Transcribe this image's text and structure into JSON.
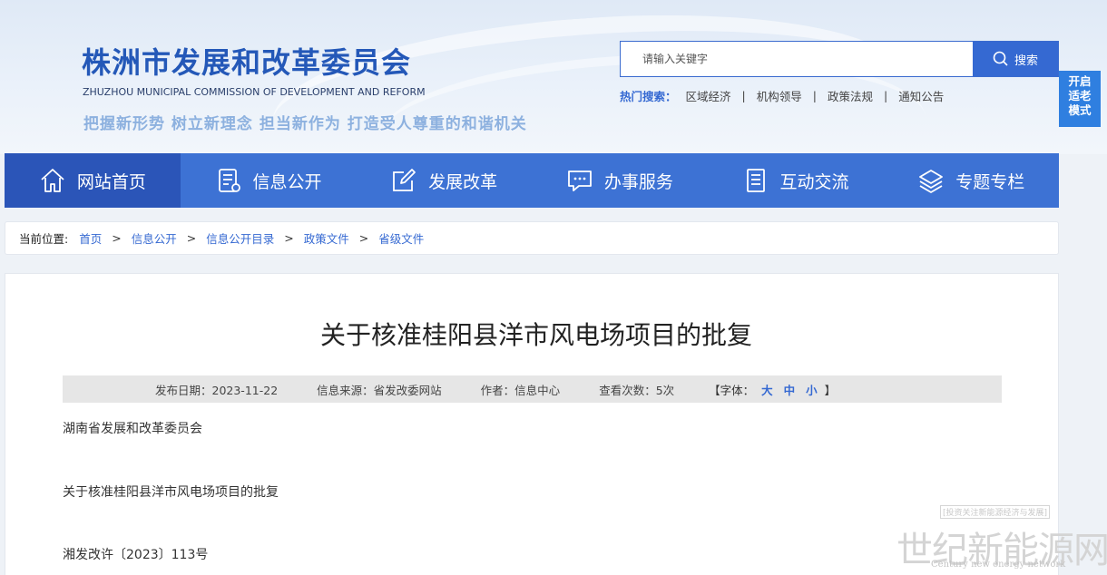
{
  "header": {
    "title_cn": "株洲市发展和改革委员会",
    "title_en": "ZHUZHOU MUNICIPAL COMMISSION OF DEVELOPMENT AND REFORM",
    "slogan": "把握新形势 树立新理念 担当新作为 打造受人尊重的和谐机关"
  },
  "search": {
    "placeholder": "请输入关键字",
    "button_label": "搜索"
  },
  "hot_search": {
    "label": "热门搜索：",
    "items": [
      "区域经济",
      "机构领导",
      "政策法规",
      "通知公告"
    ],
    "separator": "|"
  },
  "elder_mode": {
    "line1": "开启",
    "line2": "适老",
    "line3": "模式"
  },
  "nav": {
    "items": [
      {
        "label": "网站首页",
        "icon": "home-icon"
      },
      {
        "label": "信息公开",
        "icon": "document-icon"
      },
      {
        "label": "发展改革",
        "icon": "edit-icon"
      },
      {
        "label": "办事服务",
        "icon": "chat-icon"
      },
      {
        "label": "互动交流",
        "icon": "notes-icon"
      },
      {
        "label": "专题专栏",
        "icon": "layers-icon"
      }
    ]
  },
  "breadcrumb": {
    "label": "当前位置:",
    "items": [
      "首页",
      "信息公开",
      "信息公开目录",
      "政策文件",
      "省级文件"
    ],
    "separator": ">"
  },
  "article": {
    "title": "关于核准桂阳县洋市风电场项目的批复",
    "meta": {
      "date": "发布日期：2023-11-22",
      "source": "信息来源：省发改委网站",
      "author": "作者：信息中心",
      "views": "查看次数：5次",
      "font_prefix": "【字体：",
      "font_large": "大",
      "font_medium": "中",
      "font_small": "小",
      "font_suffix": "】"
    },
    "paragraphs": [
      "湖南省发展和改革委员会",
      "关于核准桂阳县洋市风电场项目的批复",
      "湘发改许〔2023〕113号"
    ]
  },
  "watermark": {
    "small": "[投资关注新能源经济与发展]",
    "big": "世纪新能源网",
    "en": "Century new energy network"
  },
  "colors": {
    "primary": "#3569d2",
    "nav_bg": "#3d72d4",
    "nav_active": "#2b55b8",
    "logo": "#2458b8"
  }
}
